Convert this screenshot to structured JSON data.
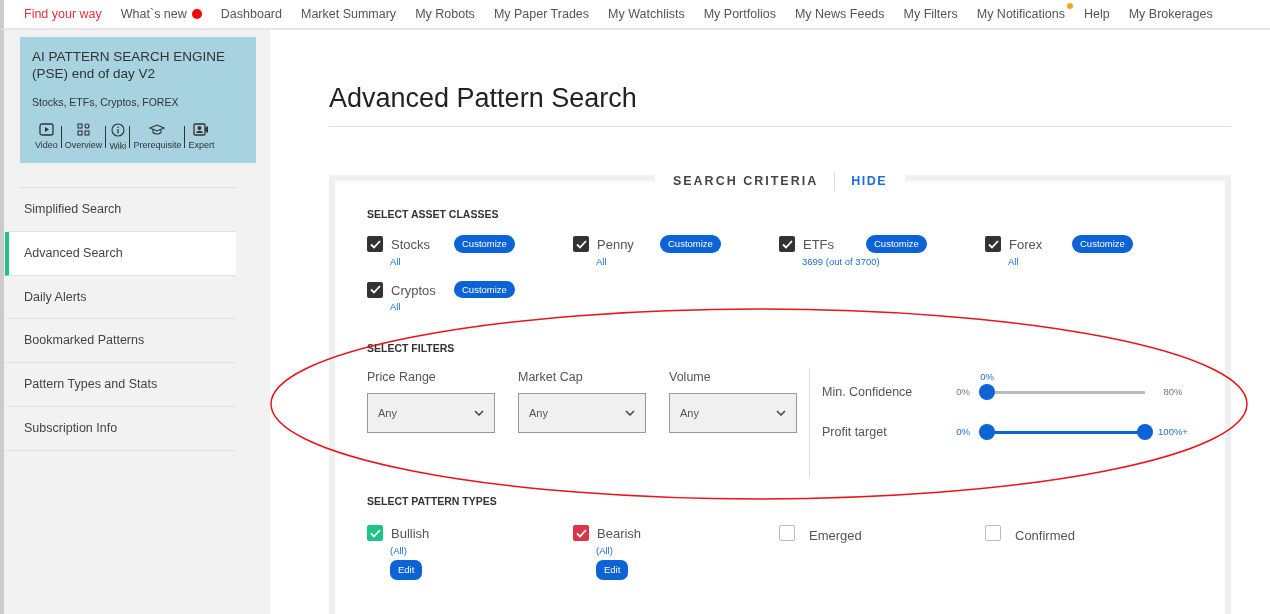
{
  "top_nav": [
    {
      "label": "Find your way",
      "selected": true
    },
    {
      "label": "What`s new",
      "selected": false,
      "color": "#ff0000"
    },
    {
      "label": "Dashboard",
      "selected": false
    },
    {
      "label": "Market Summary",
      "selected": false
    },
    {
      "label": "My Robots",
      "selected": false
    },
    {
      "label": "My Paper Trades",
      "selected": false
    },
    {
      "label": "My Watchlists",
      "selected": false
    },
    {
      "label": "My Portfolios",
      "selected": false
    },
    {
      "label": "My News Feeds",
      "selected": false
    },
    {
      "label": "My Filters",
      "selected": false
    },
    {
      "label": "My Notifications",
      "selected": false,
      "color": "#f5a623"
    },
    {
      "label": "Help",
      "selected": false
    },
    {
      "label": "My Brokerages",
      "selected": false
    }
  ],
  "product_card": {
    "title": "AI PATTERN SEARCH ENGINE (PSE) end of day V2",
    "subtitle": "Stocks, ETFs, Cryptos, FOREX",
    "links": [
      {
        "kind": "video",
        "label": "Video"
      },
      {
        "kind": "overview",
        "label": "Overview"
      },
      {
        "kind": "wiki",
        "label": "Wiki"
      },
      {
        "kind": "prerequisite",
        "label": "Prerequisite"
      },
      {
        "kind": "expert",
        "label": "Expert"
      }
    ]
  },
  "sidebar": {
    "items": [
      {
        "label": "Simplified Search",
        "selected": false
      },
      {
        "label": "Advanced Search",
        "selected": true
      },
      {
        "label": "Daily Alerts",
        "selected": false
      },
      {
        "label": "Bookmarked Patterns",
        "selected": false
      },
      {
        "label": "Pattern Types and Stats",
        "selected": false
      },
      {
        "label": "Subscription Info",
        "selected": false
      }
    ]
  },
  "page_title": "Advanced Pattern Search",
  "panel": {
    "title": "SEARCH CRITERIA",
    "toggle": "HIDE",
    "asset_classes": {
      "heading": "SELECT ASSET CLASSES",
      "items": [
        {
          "label": "Stocks",
          "checked": true,
          "button": "Customize",
          "detail": "All"
        },
        {
          "label": "Penny",
          "checked": true,
          "button": "Customize",
          "detail": "All"
        },
        {
          "label": "ETFs",
          "checked": true,
          "button": "Customize",
          "detail": "3699 (out of 3700)"
        },
        {
          "label": "Forex",
          "checked": true,
          "button": "Customize",
          "detail": "All"
        },
        {
          "label": "Cryptos",
          "checked": true,
          "button": "Customize",
          "detail": "All"
        }
      ]
    },
    "filters": {
      "heading": "SELECT FILTERS",
      "selects": [
        {
          "label": "Price Range",
          "value": "Any"
        },
        {
          "label": "Market Cap",
          "value": "Any"
        },
        {
          "label": "Volume",
          "value": "Any"
        }
      ],
      "sliders": [
        {
          "label": "Min. Confidence",
          "kind": "single",
          "level": 0,
          "min": "0%",
          "max": "80%",
          "reading": "0%"
        },
        {
          "label": "Profit target",
          "kind": "range",
          "level": 1,
          "min": "0%",
          "max": "100%+"
        }
      ]
    },
    "pattern_types": {
      "heading": "SELECT PATTERN TYPES",
      "items": [
        {
          "label": "Bullish",
          "checked": true,
          "color": "#1fc386",
          "detail": "(All)",
          "button": "Edit"
        },
        {
          "label": "Bearish",
          "checked": true,
          "color": "#dc3545",
          "detail": "(All)",
          "button": "Edit"
        },
        {
          "label": "Emerged",
          "checked": false
        },
        {
          "label": "Confirmed",
          "checked": false
        }
      ]
    }
  }
}
